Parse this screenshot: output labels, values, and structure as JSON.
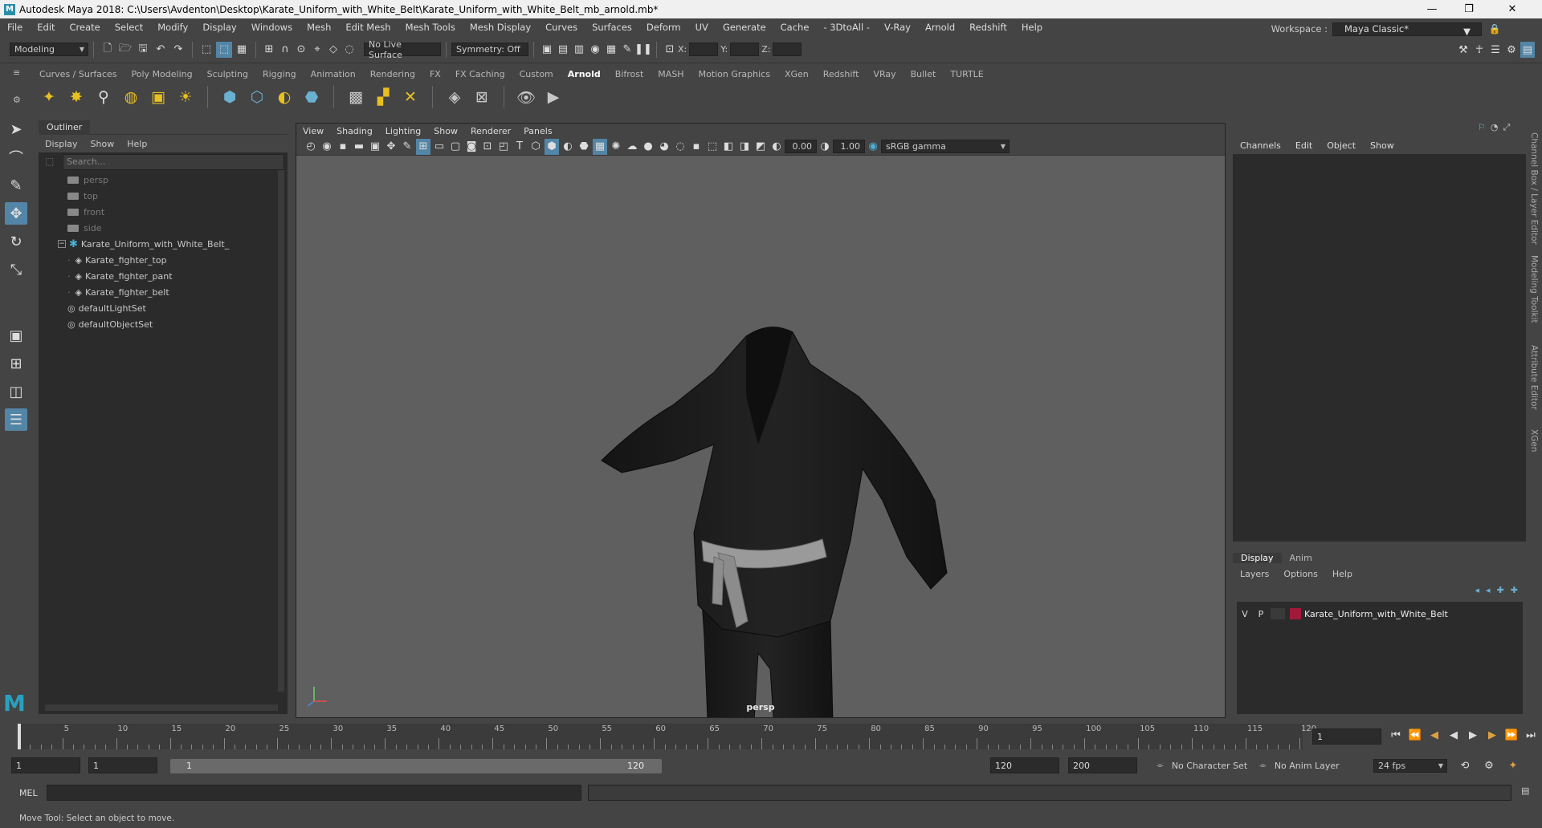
{
  "window": {
    "title": "Autodesk Maya 2018: C:\\Users\\Avdenton\\Desktop\\Karate_Uniform_with_White_Belt\\Karate_Uniform_with_White_Belt_mb_arnold.mb*",
    "logo": "M"
  },
  "menubar": {
    "items": [
      "File",
      "Edit",
      "Create",
      "Select",
      "Modify",
      "Display",
      "Windows",
      "Mesh",
      "Edit Mesh",
      "Mesh Tools",
      "Mesh Display",
      "Curves",
      "Surfaces",
      "Deform",
      "UV",
      "Generate",
      "Cache",
      "- 3DtoAll -",
      "V-Ray",
      "Arnold",
      "Redshift",
      "Help"
    ],
    "workspace_label": "Workspace :",
    "workspace_value": "Maya Classic*"
  },
  "statusline": {
    "mode": "Modeling",
    "live_surface": "No Live Surface",
    "symmetry": "Symmetry: Off",
    "x_label": "X:",
    "y_label": "Y:",
    "z_label": "Z:"
  },
  "shelf": {
    "tabs": [
      "Curves / Surfaces",
      "Poly Modeling",
      "Sculpting",
      "Rigging",
      "Animation",
      "Rendering",
      "FX",
      "FX Caching",
      "Custom",
      "Arnold",
      "Bifrost",
      "MASH",
      "Motion Graphics",
      "XGen",
      "Redshift",
      "VRay",
      "Bullet",
      "TURTLE"
    ],
    "active": "Arnold"
  },
  "outliner": {
    "title": "Outliner",
    "menu": [
      "Display",
      "Show",
      "Help"
    ],
    "search_placeholder": "Search...",
    "items": [
      {
        "label": "persp",
        "type": "camera"
      },
      {
        "label": "top",
        "type": "camera"
      },
      {
        "label": "front",
        "type": "camera"
      },
      {
        "label": "side",
        "type": "camera"
      },
      {
        "label": "Karate_Uniform_with_White_Belt_",
        "type": "group"
      },
      {
        "label": "Karate_fighter_top",
        "type": "mesh"
      },
      {
        "label": "Karate_fighter_pant",
        "type": "mesh"
      },
      {
        "label": "Karate_fighter_belt",
        "type": "mesh"
      },
      {
        "label": "defaultLightSet",
        "type": "set"
      },
      {
        "label": "defaultObjectSet",
        "type": "set"
      }
    ]
  },
  "viewport": {
    "menu": [
      "View",
      "Shading",
      "Lighting",
      "Show",
      "Renderer",
      "Panels"
    ],
    "exposure": "0.00",
    "gamma": "1.00",
    "colorspace": "sRGB gamma",
    "camera_label": "persp"
  },
  "channelbox": {
    "menu": [
      "Channels",
      "Edit",
      "Object",
      "Show"
    ]
  },
  "layers": {
    "tabs": [
      "Display",
      "Anim"
    ],
    "active_tab": "Display",
    "menu": [
      "Layers",
      "Options",
      "Help"
    ],
    "rows": [
      {
        "v": "V",
        "p": "P",
        "name": "Karate_Uniform_with_White_Belt",
        "color": "#a3193a"
      }
    ]
  },
  "side_tabs": [
    "Channel Box / Layer Editor",
    "Modeling Toolkit",
    "Attribute Editor",
    "XGen"
  ],
  "timeline": {
    "ticks": [
      "5",
      "10",
      "15",
      "20",
      "25",
      "30",
      "35",
      "40",
      "45",
      "50",
      "55",
      "60",
      "65",
      "70",
      "75",
      "80",
      "85",
      "90",
      "95",
      "100",
      "105",
      "110",
      "115",
      "120"
    ],
    "current_frame": "1",
    "range_start": "1",
    "range_start2": "1",
    "slider_start": "1",
    "slider_end": "120",
    "end_frame": "120",
    "max_frame": "200",
    "character_set": "No Character Set",
    "anim_layer": "No Anim Layer",
    "fps": "24 fps"
  },
  "commandline": {
    "label": "MEL"
  },
  "helpline": {
    "text": "Move Tool: Select an object to move."
  },
  "colors": {
    "accent": "#5285a6",
    "gi_black": "#1b1b1b",
    "belt_white": "#9a9a9a"
  }
}
